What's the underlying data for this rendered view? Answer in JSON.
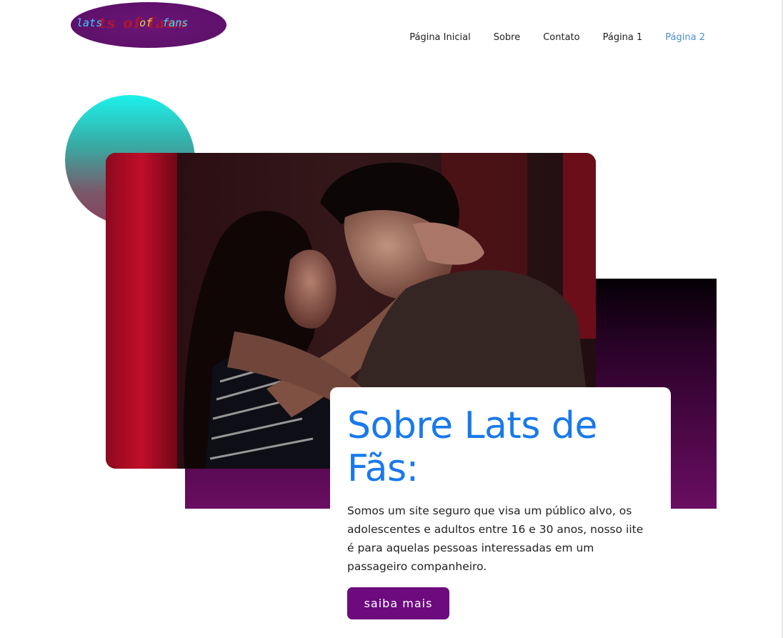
{
  "header": {
    "logo": {
      "word1": "lats",
      "word2": "of",
      "word3": "fans",
      "shadow_text": "ts of fans"
    },
    "nav": [
      {
        "label": "Página Inicial",
        "active": false
      },
      {
        "label": "Sobre",
        "active": false
      },
      {
        "label": "Contato",
        "active": false
      },
      {
        "label": "Página 1",
        "active": false
      },
      {
        "label": "Página 2",
        "active": true
      }
    ]
  },
  "hero": {
    "image": "couple-dancing-photo"
  },
  "about": {
    "title": "Sobre Lats de Fãs:",
    "body": "Somos um site seguro que visa um público alvo, os adolescentes e adultos entre 16 e 30 anos, nosso iite é para aquelas pessoas interessadas em um passageiro companheiro.",
    "button_label": "saiba mais"
  },
  "colors": {
    "accent_blue": "#1979ec",
    "nav_active": "#4a8fd3",
    "button_purple": "#6d0a7e",
    "circle_top": "#1af2ea",
    "block_bottom": "#6a0e62"
  }
}
